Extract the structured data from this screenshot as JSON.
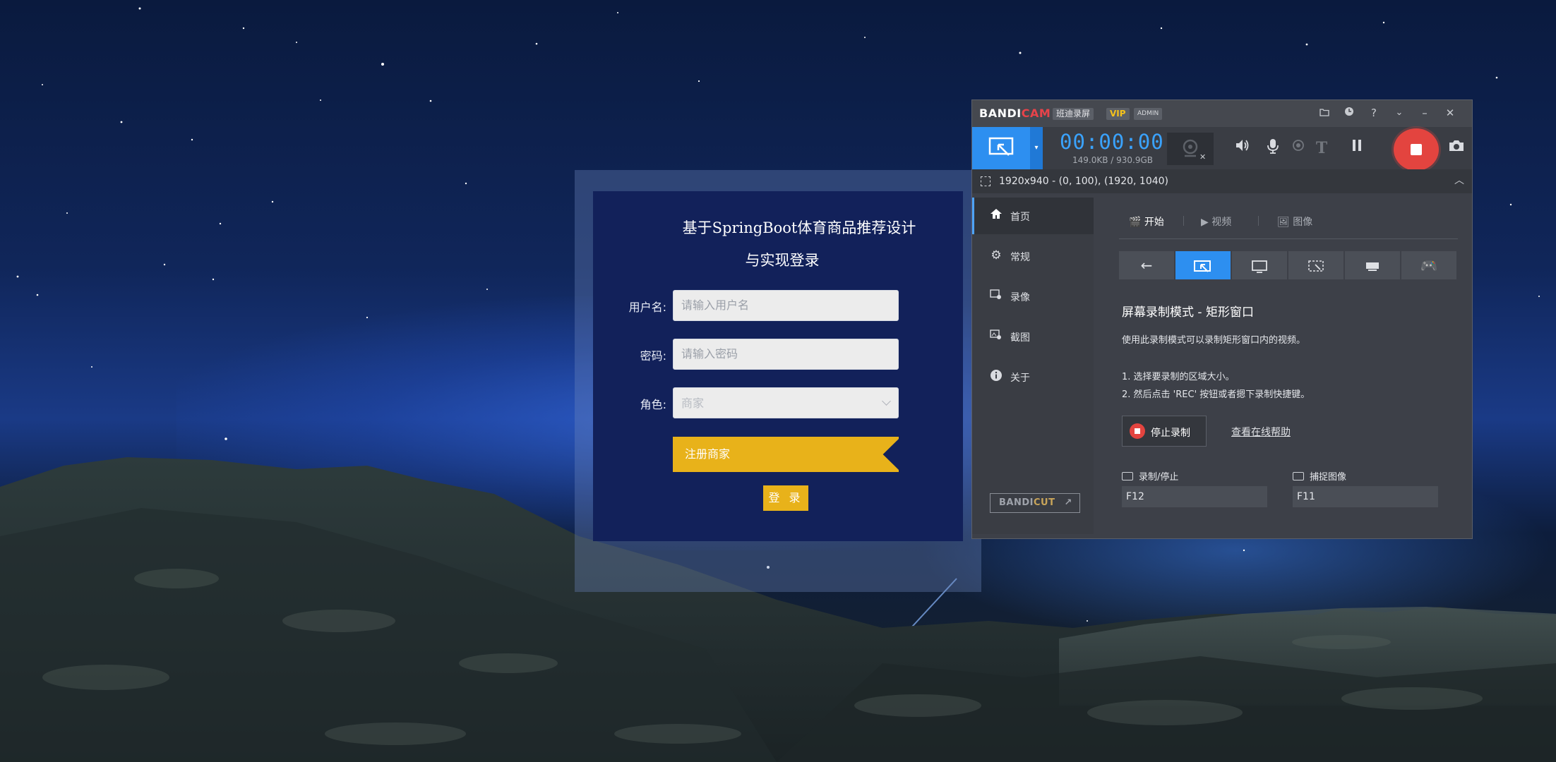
{
  "login": {
    "title_line1": "基于SpringBoot体育商品推荐设计",
    "title_line2": "与实现登录",
    "username_label": "用户名:",
    "username_placeholder": "请输入用户名",
    "password_label": "密码:",
    "password_placeholder": "请输入密码",
    "role_label": "角色:",
    "role_value": "商家",
    "register_label": "注册商家",
    "login_label": "登 录"
  },
  "bandicam": {
    "logo_a": "BANDI",
    "logo_b": "CAM",
    "tag_cn": "班迪录屏",
    "tag_vip": "VIP",
    "tag_admin": "ADMIN",
    "timer": "00:00:00",
    "filesize": "149.0KB / 930.9GB",
    "area": "1920x940 - (0, 100), (1920, 1040)",
    "sidebar": [
      {
        "label": "首页",
        "icon": "home-icon"
      },
      {
        "label": "常规",
        "icon": "gear-icon"
      },
      {
        "label": "录像",
        "icon": "video-settings-icon"
      },
      {
        "label": "截图",
        "icon": "image-settings-icon"
      },
      {
        "label": "关于",
        "icon": "info-icon"
      }
    ],
    "bandicut_a": "BANDI",
    "bandicut_b": "CUT",
    "tabs": [
      "开始",
      "视频",
      "图像"
    ],
    "mode_title": "屏幕录制模式 - 矩形窗口",
    "mode_desc": "使用此录制模式可以录制矩形窗口内的视频。",
    "step1": "1. 选择要录制的区域大小。",
    "step2": "2. 然后点击 'REC' 按钮或者摁下录制快捷键。",
    "stop_label": "停止录制",
    "help_link": "查看在线帮助",
    "hotkey_record_label": "录制/停止",
    "hotkey_record_value": "F12",
    "hotkey_capture_label": "捕捉图像",
    "hotkey_capture_value": "F11",
    "accent_color": "#2d8ff0",
    "rec_color": "#e3443f"
  }
}
